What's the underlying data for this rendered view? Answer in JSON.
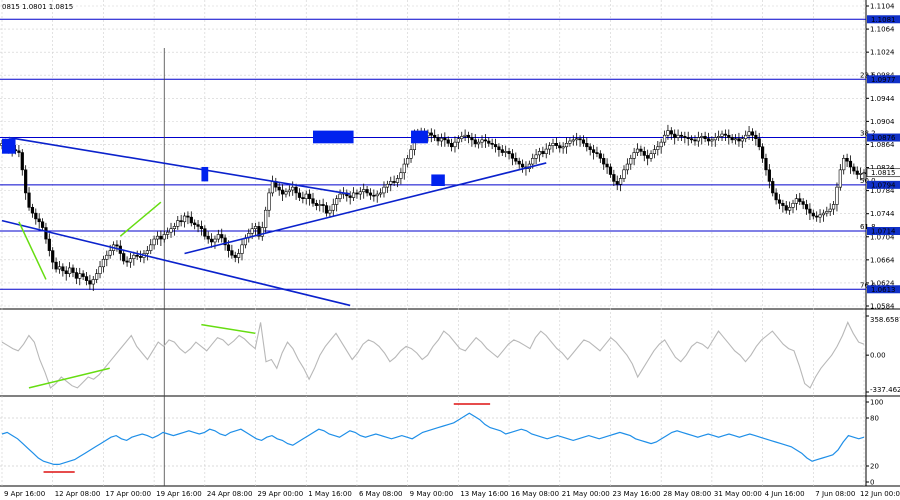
{
  "header": {
    "ohlc_text": "0815 1.0801 1.0815"
  },
  "colors": {
    "candle": "#000000",
    "level_line": "#0000cc",
    "trend_line": "#0b22cc",
    "marker_box": "#0022ee",
    "green_line": "#66dd11",
    "cci_line": "#b8b8b8",
    "rsi_line": "#1f8fe8",
    "red_mark": "#dd1111",
    "price_label_bg": "#1030c8",
    "current_label_bg": "#ffffff",
    "grid": "#cfcfcf"
  },
  "chart_data": [
    {
      "type": "candlestick",
      "panel": "price",
      "ylim": [
        1.0584,
        1.1104
      ],
      "y_ticks": [
        "1.1104",
        "1.1064",
        "1.1024",
        "1.0984",
        "1.0944",
        "1.0904",
        "1.0864",
        "1.0824",
        "1.0784",
        "1.0744",
        "1.0704",
        "1.0664",
        "1.0624",
        "1.0584"
      ],
      "x_ticks": [
        "9 Apr 16:00",
        "12 Apr 08:00",
        "17 Apr 00:00",
        "19 Apr 16:00",
        "24 Apr 08:00",
        "29 Apr 00:00",
        "1 May 16:00",
        "6 May 08:00",
        "9 May 00:00",
        "13 May 16:00",
        "16 May 08:00",
        "21 May 00:00",
        "23 May 16:00",
        "28 May 08:00",
        "31 May 00:00",
        "4 Jun 16:00",
        "7 Jun 08:00",
        "12 Jun 00:00"
      ],
      "close_path": [
        1.0866,
        1.0862,
        1.0858,
        1.0855,
        1.0853,
        1.085,
        1.082,
        1.078,
        1.0755,
        1.0745,
        1.0735,
        1.073,
        1.072,
        1.07,
        1.068,
        1.066,
        1.0648,
        1.0652,
        1.0645,
        1.064,
        1.065,
        1.0642,
        1.0632,
        1.064,
        1.0635,
        1.0628,
        1.0622,
        1.063,
        1.064,
        1.0652,
        1.0665,
        1.0672,
        1.068,
        1.069,
        1.0688,
        1.0675,
        1.0662,
        1.066,
        1.0666,
        1.0672,
        1.067,
        1.0668,
        1.0675,
        1.068,
        1.069,
        1.07,
        1.0705,
        1.07,
        1.0708,
        1.0712,
        1.0718,
        1.0722,
        1.0732,
        1.073,
        1.074,
        1.0738,
        1.0728,
        1.0725,
        1.0722,
        1.0718,
        1.0705,
        1.07,
        1.0695,
        1.07,
        1.0708,
        1.0702,
        1.069,
        1.068,
        1.0672,
        1.0668,
        1.0675,
        1.069,
        1.0702,
        1.071,
        1.0718,
        1.0722,
        1.0705,
        1.072,
        1.075,
        1.078,
        1.08,
        1.079,
        1.0785,
        1.0778,
        1.0782,
        1.0785,
        1.079,
        1.078,
        1.0772,
        1.077,
        1.0778,
        1.077,
        1.0762,
        1.0758,
        1.076,
        1.0758,
        1.0745,
        1.075,
        1.076,
        1.077,
        1.0778,
        1.078,
        1.0775,
        1.0772,
        1.078,
        1.0778,
        1.0782,
        1.0786,
        1.078,
        1.0776,
        1.0775,
        1.0778,
        1.078,
        1.079,
        1.0795,
        1.08,
        1.0798,
        1.0805,
        1.0815,
        1.083,
        1.084,
        1.0855,
        1.088,
        1.0885,
        1.0882,
        1.0879,
        1.0884,
        1.088,
        1.0876,
        1.087,
        1.0875,
        1.0872,
        1.0866,
        1.086,
        1.0868,
        1.0874,
        1.0878,
        1.088,
        1.0876,
        1.0872,
        1.0865,
        1.0868,
        1.0872,
        1.087,
        1.0866,
        1.0864,
        1.086,
        1.0855,
        1.085,
        1.0852,
        1.0848,
        1.084,
        1.0835,
        1.083,
        1.0825,
        1.0822,
        1.083,
        1.084,
        1.0846,
        1.0852,
        1.0848,
        1.0856,
        1.0862,
        1.0866,
        1.0862,
        1.0858,
        1.086,
        1.0866,
        1.087,
        1.0872,
        1.0874,
        1.0872,
        1.0866,
        1.086,
        1.0855,
        1.085,
        1.0848,
        1.084,
        1.083,
        1.0825,
        1.0812,
        1.08,
        1.0795,
        1.0805,
        1.082,
        1.083,
        1.084,
        1.085,
        1.0856,
        1.0852,
        1.0845,
        1.084,
        1.0848,
        1.0855,
        1.086,
        1.0868,
        1.088,
        1.0888,
        1.0882,
        1.0876,
        1.088,
        1.0878,
        1.0876,
        1.0874,
        1.0872,
        1.087,
        1.0876,
        1.0878,
        1.0874,
        1.087,
        1.0872,
        1.0876,
        1.0878,
        1.0882,
        1.088,
        1.0876,
        1.0872,
        1.0874,
        1.087,
        1.0874,
        1.088,
        1.0886,
        1.088,
        1.0874,
        1.086,
        1.084,
        1.082,
        1.08,
        1.078,
        1.0768,
        1.0762,
        1.0758,
        1.075,
        1.0755,
        1.0762,
        1.077,
        1.0765,
        1.076,
        1.0752,
        1.0745,
        1.074,
        1.0738,
        1.0742,
        1.0745,
        1.0748,
        1.0752,
        1.076,
        1.079,
        1.082,
        1.084,
        1.0835,
        1.0825,
        1.0818,
        1.0812,
        1.0814,
        1.0815
      ],
      "price_levels": [
        {
          "value": 1.1081,
          "label": "1.1081",
          "fib": ""
        },
        {
          "value": 1.0977,
          "label": "1.0977",
          "fib": "23.6"
        },
        {
          "value": 1.0876,
          "label": "1.0876",
          "fib": "38.2"
        },
        {
          "value": 1.0794,
          "label": "1.0794",
          "fib": "50.0"
        },
        {
          "value": 1.0714,
          "label": "1.0714",
          "fib": "61.8"
        },
        {
          "value": 1.0613,
          "label": "1.0613",
          "fib": "76.4"
        }
      ],
      "current_price": {
        "value": 1.0815,
        "label": "1.0815"
      },
      "trend_lines": [
        {
          "x": [
            0,
            103
          ],
          "y": [
            1.0732,
            1.0585
          ]
        },
        {
          "x": [
            2,
            103
          ],
          "y": [
            1.0876,
            1.0778
          ]
        },
        {
          "x": [
            54,
            161
          ],
          "y": [
            1.0675,
            1.0832
          ]
        }
      ],
      "annotations": [
        {
          "x": [
            0,
            4
          ],
          "y": [
            1.0874,
            1.0848
          ],
          "label": ""
        },
        {
          "x": [
            59,
            61
          ],
          "y": [
            1.0825,
            1.08
          ],
          "label": ""
        },
        {
          "x": [
            92,
            104
          ],
          "y": [
            1.0888,
            1.0866
          ],
          "label": ""
        },
        {
          "x": [
            121,
            126
          ],
          "y": [
            1.0888,
            1.0866
          ],
          "label": ""
        },
        {
          "x": [
            127,
            131
          ],
          "y": [
            1.0812,
            1.0792
          ],
          "label": ""
        }
      ],
      "green_lines": [
        {
          "x": [
            5,
            13
          ],
          "y": [
            1.073,
            1.063
          ]
        },
        {
          "x": [
            35,
            47
          ],
          "y": [
            1.0705,
            1.0764
          ]
        }
      ],
      "vertical_line_x": 48
    },
    {
      "type": "line",
      "panel": "cci",
      "y_ticks": [
        "358.6587",
        "0.00",
        "-337.462"
      ],
      "ylim": [
        -337.462,
        358.6587
      ],
      "x_start": 0,
      "values": [
        120,
        90,
        60,
        40,
        100,
        180,
        120,
        -40,
        -160,
        -300,
        -260,
        -200,
        -240,
        -280,
        -300,
        -250,
        -200,
        -220,
        -180,
        -120,
        -60,
        0,
        60,
        120,
        180,
        80,
        20,
        -40,
        40,
        120,
        80,
        140,
        120,
        60,
        20,
        60,
        120,
        80,
        40,
        100,
        160,
        140,
        90,
        130,
        180,
        150,
        100,
        60,
        300,
        -60,
        -40,
        -120,
        20,
        120,
        60,
        -40,
        -120,
        -220,
        -120,
        0,
        80,
        140,
        200,
        120,
        40,
        -40,
        20,
        100,
        140,
        120,
        80,
        20,
        -60,
        -20,
        40,
        80,
        60,
        20,
        -40,
        0,
        80,
        140,
        220,
        180,
        120,
        60,
        40,
        100,
        160,
        120,
        60,
        20,
        -20,
        40,
        100,
        140,
        120,
        90,
        60,
        160,
        220,
        180,
        120,
        60,
        20,
        -40,
        20,
        80,
        140,
        120,
        80,
        40,
        100,
        160,
        120,
        60,
        0,
        -80,
        -200,
        -120,
        -40,
        40,
        100,
        140,
        60,
        -20,
        -60,
        0,
        80,
        120,
        100,
        60,
        140,
        220,
        160,
        100,
        40,
        0,
        -60,
        0,
        80,
        140,
        180,
        220,
        160,
        100,
        60,
        40,
        -100,
        -260,
        -300,
        -200,
        -120,
        -60,
        0,
        80,
        180,
        300,
        200,
        120,
        100
      ],
      "green_lines": [
        {
          "x": [
            5,
            20
          ],
          "y": [
            -300,
            -120
          ]
        },
        {
          "x": [
            37,
            47
          ],
          "y": [
            280,
            200
          ]
        }
      ]
    },
    {
      "type": "line",
      "panel": "rsi",
      "y_ticks": [
        "100",
        "80",
        "20",
        "0"
      ],
      "ylim": [
        0,
        100
      ],
      "x_start": 0,
      "values": [
        60,
        62,
        58,
        54,
        48,
        42,
        36,
        30,
        26,
        24,
        22,
        22,
        24,
        26,
        28,
        32,
        36,
        40,
        44,
        48,
        52,
        56,
        58,
        54,
        52,
        56,
        58,
        60,
        58,
        55,
        58,
        62,
        60,
        58,
        60,
        62,
        64,
        62,
        60,
        62,
        66,
        64,
        60,
        58,
        62,
        64,
        66,
        62,
        58,
        54,
        52,
        56,
        58,
        54,
        52,
        48,
        46,
        50,
        54,
        58,
        62,
        66,
        64,
        60,
        58,
        56,
        60,
        64,
        62,
        58,
        56,
        58,
        60,
        58,
        56,
        54,
        56,
        58,
        56,
        54,
        58,
        62,
        64,
        66,
        68,
        70,
        72,
        74,
        78,
        82,
        86,
        82,
        78,
        72,
        68,
        66,
        64,
        60,
        62,
        64,
        66,
        64,
        60,
        58,
        56,
        54,
        56,
        58,
        56,
        54,
        52,
        54,
        56,
        58,
        56,
        54,
        56,
        58,
        60,
        62,
        60,
        58,
        54,
        52,
        50,
        48,
        50,
        54,
        58,
        62,
        64,
        62,
        60,
        58,
        56,
        58,
        60,
        58,
        56,
        58,
        60,
        58,
        56,
        58,
        60,
        58,
        56,
        54,
        52,
        50,
        48,
        46,
        44,
        40,
        36,
        30,
        26,
        28,
        30,
        32,
        34,
        40,
        50,
        58,
        56,
        54,
        56
      ],
      "red_marks": [
        {
          "x": [
            8,
            14
          ],
          "y": 5
        },
        {
          "x": [
            87,
            94
          ],
          "y": 100
        }
      ]
    }
  ]
}
